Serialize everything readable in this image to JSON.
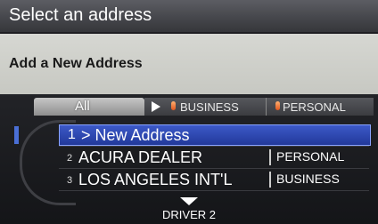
{
  "header": {
    "title": "Select an address"
  },
  "subheader": {
    "text": "Add a New Address"
  },
  "tabs": [
    {
      "label": "All",
      "active": true
    },
    {
      "label": "BUSINESS",
      "icon": "play-arrow-icon",
      "pin_icon": "location-pin-icon"
    },
    {
      "label": "PERSONAL",
      "pin_icon": "location-pin-icon"
    }
  ],
  "list": {
    "rows": [
      {
        "number": "1",
        "text": "> New Address",
        "category": "",
        "selected": true
      },
      {
        "number": "2",
        "text": "ACURA DEALER",
        "category": "PERSONAL"
      },
      {
        "number": "3",
        "text": "LOS ANGELES INT'L",
        "category": "BUSINESS"
      }
    ]
  },
  "footer": {
    "driver": "DRIVER 2",
    "scroll_icon": "down-arrow-icon"
  },
  "colors": {
    "selected_row": "#2c45ae",
    "pin": "#e0561d",
    "header_bg": "#4e4f54",
    "subheader_bg": "#cfd0ca"
  }
}
